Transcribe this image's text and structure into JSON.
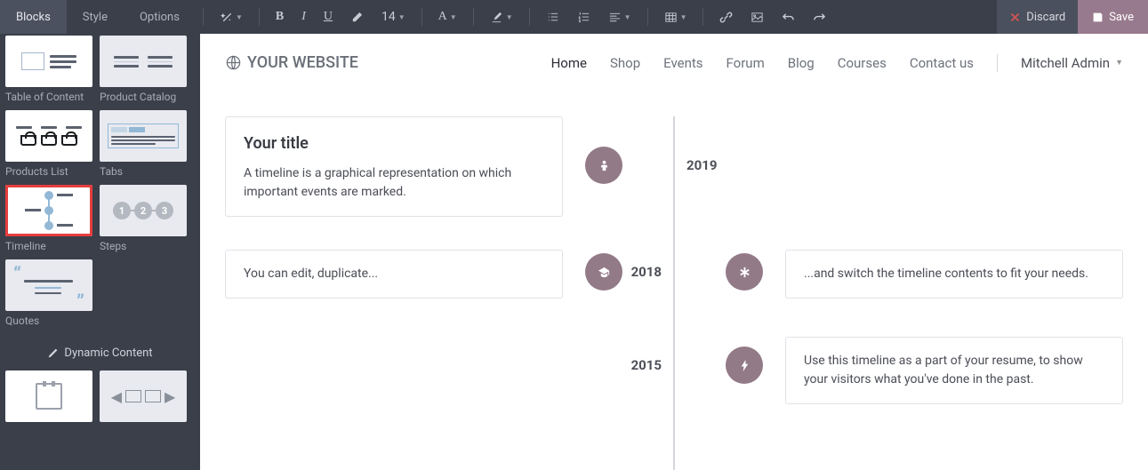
{
  "toolbar": {
    "tabs": {
      "blocks": "Blocks",
      "style": "Style",
      "options": "Options"
    },
    "font_size": "14",
    "discard_label": "Discard",
    "save_label": "Save"
  },
  "sidebar": {
    "items": [
      {
        "label": "Table of Content"
      },
      {
        "label": "Product Catalog"
      },
      {
        "label": "Products List"
      },
      {
        "label": "Tabs"
      },
      {
        "label": "Timeline"
      },
      {
        "label": "Steps"
      },
      {
        "label": "Quotes"
      }
    ],
    "dynamic_section": "Dynamic Content"
  },
  "site": {
    "logo_text": "YOUR WEBSITE",
    "nav": {
      "home": "Home",
      "shop": "Shop",
      "events": "Events",
      "forum": "Forum",
      "blog": "Blog",
      "courses": "Courses",
      "contact": "Contact us"
    },
    "user": "Mitchell Admin"
  },
  "timeline": {
    "rows": [
      {
        "year": "2019",
        "title": "Your title",
        "desc": "A timeline is a graphical representation on which important events are marked."
      },
      {
        "year": "2018",
        "left_text": "You can edit, duplicate...",
        "right_text": "...and switch the timeline contents to fit your needs."
      },
      {
        "year": "2015",
        "right_text": "Use this timeline as a part of your resume, to show your visitors what you've done in the past."
      }
    ]
  }
}
